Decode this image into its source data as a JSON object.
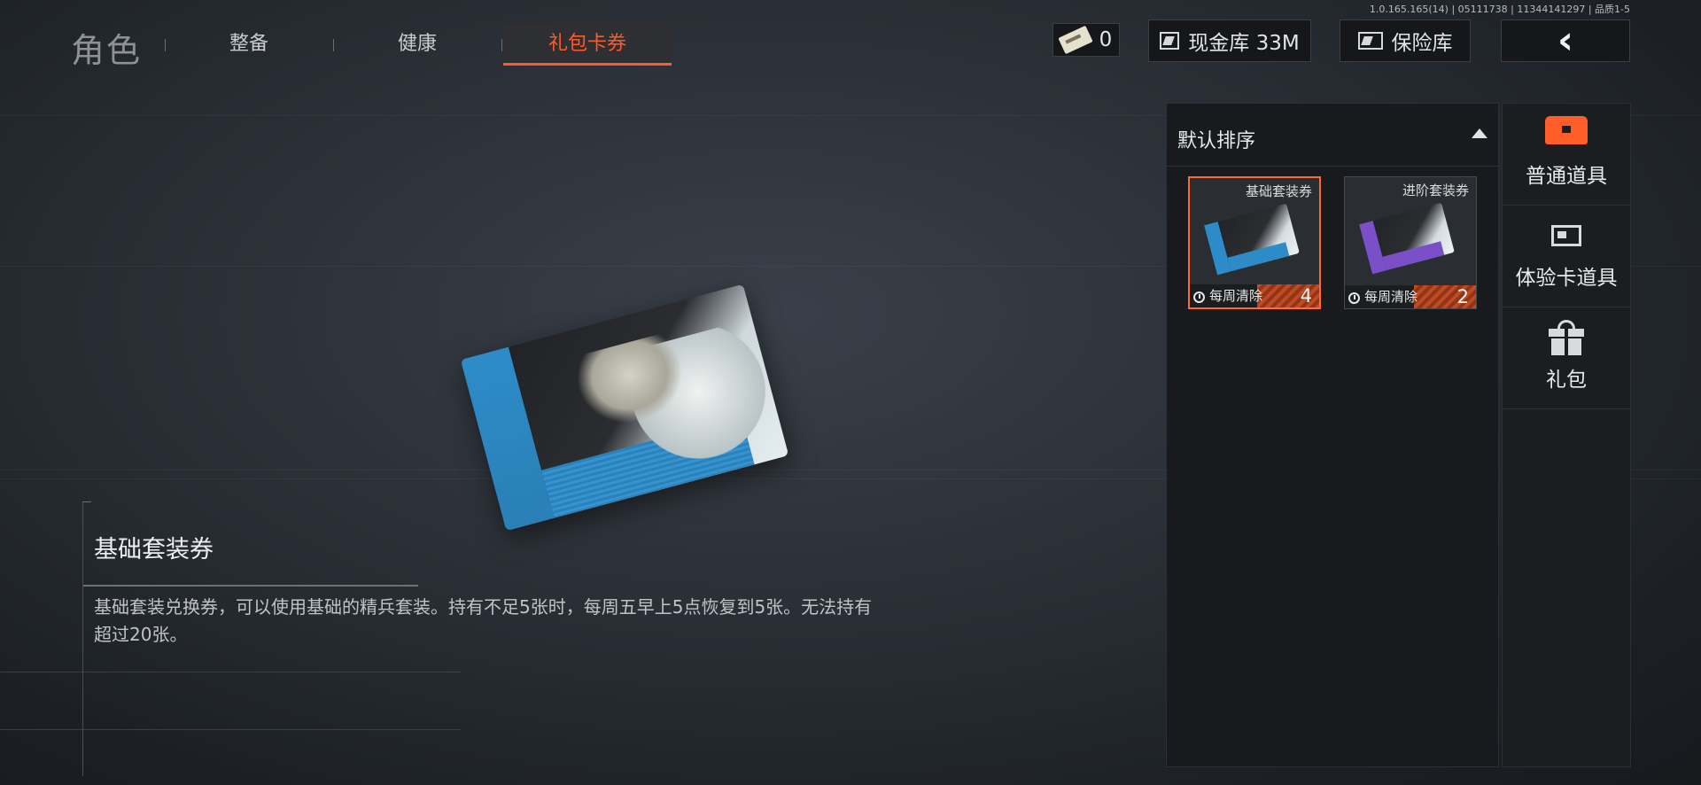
{
  "build_info": "1.0.165.165(14) | 05111738 | 11344141297 | 品质1-5",
  "nav": {
    "title": "角色",
    "tabs": [
      {
        "label": "整备"
      },
      {
        "label": "健康"
      },
      {
        "label": "礼包卡券"
      }
    ],
    "active_tab": "礼包卡券"
  },
  "header": {
    "tickets": "0",
    "cash_label": "现金库 33M",
    "vault_label": "保险库"
  },
  "selected_item": {
    "name": "基础套装券",
    "description": "基础套装兑换券，可以使用基础的精兵套装。持有不足5张时，每周五早上5点恢复到5张。无法持有超过20张。"
  },
  "list": {
    "sort_label": "默认排序",
    "items": [
      {
        "name": "基础套装券",
        "expire": "每周清除",
        "count": "4",
        "accent": "#2d8cc8"
      },
      {
        "name": "进阶套装券",
        "expire": "每周清除",
        "count": "2",
        "accent": "#7a4fc8"
      }
    ]
  },
  "categories": [
    {
      "label": "普通道具",
      "icon": "chest-icon",
      "active": true
    },
    {
      "label": "体验卡道具",
      "icon": "card-icon"
    },
    {
      "label": "礼包",
      "icon": "gift-icon"
    }
  ],
  "colors": {
    "accent": "#ff5a2a",
    "panel": "#181a1d"
  }
}
